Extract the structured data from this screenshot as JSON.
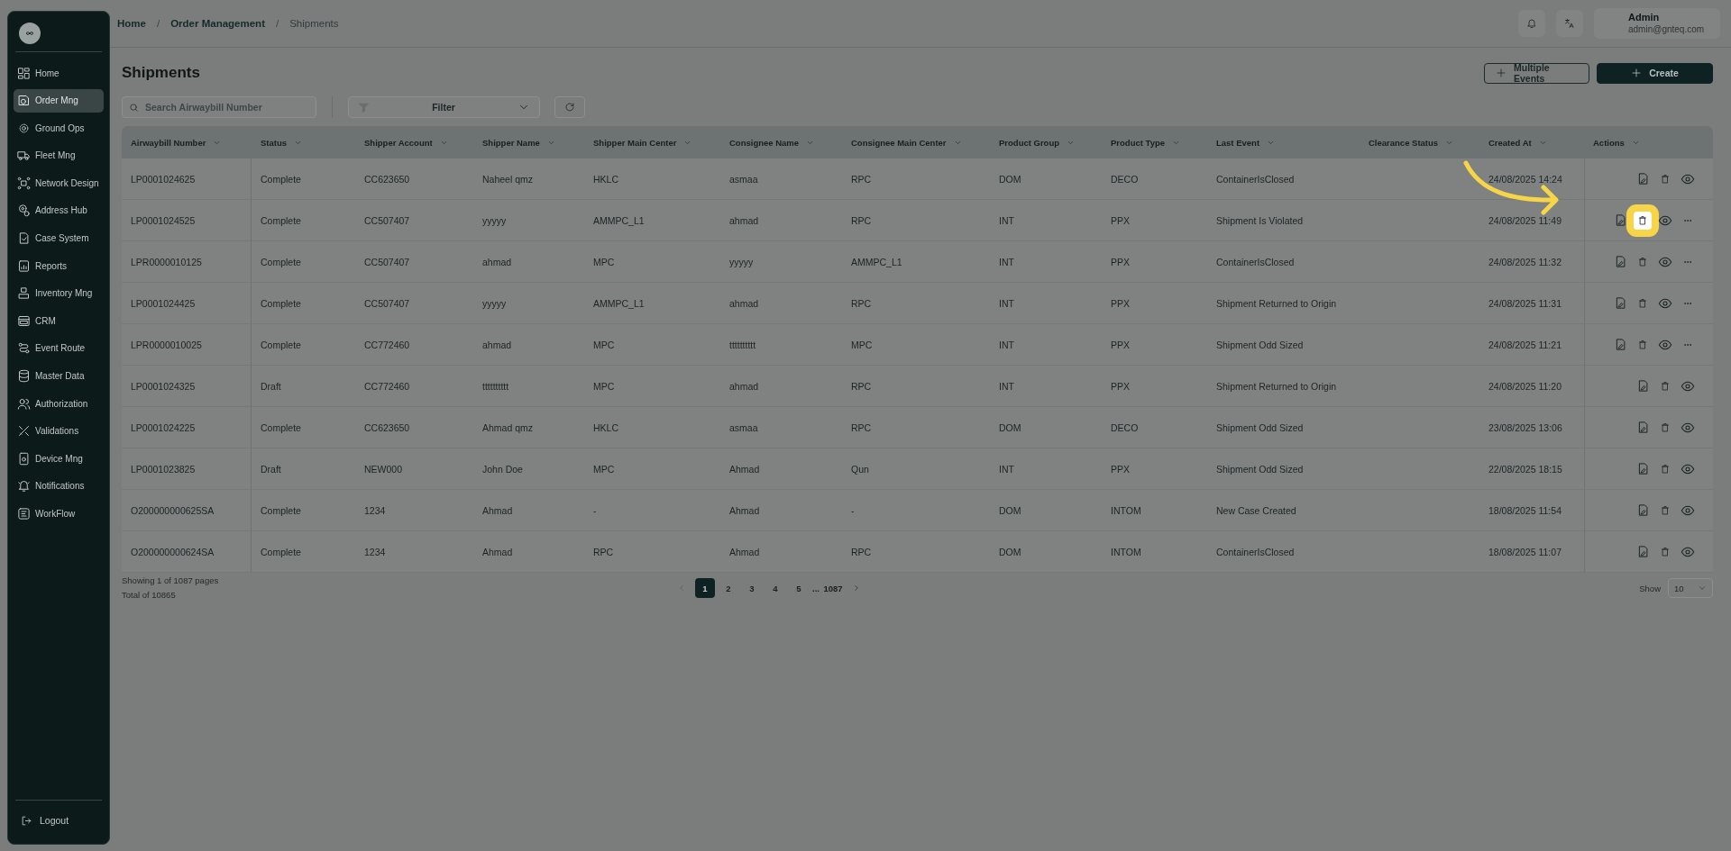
{
  "sidebar": {
    "items": [
      {
        "label": "Home",
        "selected": false
      },
      {
        "label": "Order Mng",
        "selected": true
      },
      {
        "label": "Ground Ops",
        "selected": false
      },
      {
        "label": "Fleet Mng",
        "selected": false
      },
      {
        "label": "Network Design",
        "selected": false
      },
      {
        "label": "Address Hub",
        "selected": false
      },
      {
        "label": "Case System",
        "selected": false
      },
      {
        "label": "Reports",
        "selected": false
      },
      {
        "label": "Inventory Mng",
        "selected": false
      },
      {
        "label": "CRM",
        "selected": false
      },
      {
        "label": "Event Route",
        "selected": false
      },
      {
        "label": "Master Data",
        "selected": false
      },
      {
        "label": "Authorization",
        "selected": false
      },
      {
        "label": "Validations",
        "selected": false
      },
      {
        "label": "Device Mng",
        "selected": false
      },
      {
        "label": "Notifications",
        "selected": false
      },
      {
        "label": "WorkFlow",
        "selected": false
      }
    ],
    "logout": "Logout"
  },
  "breadcrumb": [
    {
      "label": "Home",
      "current": false
    },
    {
      "label": "Order Management",
      "current": false
    },
    {
      "label": "Shipments",
      "current": true
    }
  ],
  "breadcrumb_separator": "/",
  "user": {
    "name": "Admin",
    "email": "admin@gnteq.com"
  },
  "page_title": "Shipments",
  "buttons": [
    {
      "label": "Multiple Events",
      "kind": "outline"
    },
    {
      "label": "Create",
      "kind": "primary"
    }
  ],
  "search": {
    "placeholder": "Search Airwaybill Number"
  },
  "filter": {
    "label": "Filter"
  },
  "table": {
    "columns": [
      "Airwaybill Number",
      "Status",
      "Shipper Account",
      "Shipper Name",
      "Shipper Main Center",
      "Consignee Name",
      "Consignee Main Center",
      "Product Group",
      "Product Type",
      "Last Event",
      "Clearance Status",
      "Created At",
      "Actions"
    ],
    "rows": [
      {
        "cells": [
          "LP0001024625",
          "Complete",
          "CC623650",
          "Naheel qmz",
          "HKLC",
          "asmaa",
          "RPC",
          "DOM",
          "DECO",
          "ContainerIsClosed",
          "",
          "24/08/2025 14:24"
        ],
        "more": false,
        "highlighted": false
      },
      {
        "cells": [
          "LP0001024525",
          "Complete",
          "CC507407",
          "yyyyy",
          "AMMPC_L1",
          "ahmad",
          "RPC",
          "INT",
          "PPX",
          "Shipment Is Violated",
          "",
          "24/08/2025 11:49"
        ],
        "more": true,
        "highlighted": true
      },
      {
        "cells": [
          "LPR0000010125",
          "Complete",
          "CC507407",
          "ahmad",
          "MPC",
          "yyyyy",
          "AMMPC_L1",
          "INT",
          "PPX",
          "ContainerIsClosed",
          "",
          "24/08/2025 11:32"
        ],
        "more": true,
        "highlighted": false
      },
      {
        "cells": [
          "LP0001024425",
          "Complete",
          "CC507407",
          "yyyyy",
          "AMMPC_L1",
          "ahmad",
          "RPC",
          "INT",
          "PPX",
          "Shipment Returned to Origin",
          "",
          "24/08/2025 11:31"
        ],
        "more": true,
        "highlighted": false
      },
      {
        "cells": [
          "LPR0000010025",
          "Complete",
          "CC772460",
          "ahmad",
          "MPC",
          "tttttttttt",
          "MPC",
          "INT",
          "PPX",
          "Shipment Odd Sized",
          "",
          "24/08/2025 11:21"
        ],
        "more": true,
        "highlighted": false
      },
      {
        "cells": [
          "LP0001024325",
          "Draft",
          "CC772460",
          "tttttttttt",
          "MPC",
          "ahmad",
          "RPC",
          "INT",
          "PPX",
          "Shipment Returned to Origin",
          "",
          "24/08/2025 11:20"
        ],
        "more": false,
        "highlighted": false
      },
      {
        "cells": [
          "LP0001024225",
          "Complete",
          "CC623650",
          "Ahmad qmz",
          "HKLC",
          "asmaa",
          "RPC",
          "DOM",
          "DECO",
          "Shipment Odd Sized",
          "",
          "23/08/2025 13:06"
        ],
        "more": false,
        "highlighted": false
      },
      {
        "cells": [
          "LP0001023825",
          "Draft",
          "NEW000",
          "John Doe",
          "MPC",
          "Ahmad",
          "Qun",
          "INT",
          "PPX",
          "Shipment Odd Sized",
          "",
          "22/08/2025 18:15"
        ],
        "more": false,
        "highlighted": false
      },
      {
        "cells": [
          "O200000000625SA",
          "Complete",
          "1234",
          "Ahmad",
          "-",
          "Ahmad",
          "-",
          "DOM",
          "INTOM",
          "New Case Created",
          "",
          "18/08/2025 11:54"
        ],
        "more": false,
        "highlighted": false
      },
      {
        "cells": [
          "O200000000624SA",
          "Complete",
          "1234",
          "Ahmad",
          "RPC",
          "Ahmad",
          "RPC",
          "DOM",
          "INTOM",
          "ContainerIsClosed",
          "",
          "18/08/2025 11:07"
        ],
        "more": false,
        "highlighted": false
      }
    ]
  },
  "footer": {
    "showing": "Showing 1 of 1087 pages",
    "total": "Total of 10865"
  },
  "pagination": [
    {
      "label": "1",
      "selected": true
    },
    {
      "label": "2",
      "selected": false
    },
    {
      "label": "3",
      "selected": false
    },
    {
      "label": "4",
      "selected": false
    },
    {
      "label": "5",
      "selected": false
    },
    {
      "label": "...",
      "kind": "gap",
      "selected": false
    },
    {
      "label": "1087",
      "selected": false
    }
  ],
  "page_size": {
    "label": "Show",
    "value": "10"
  },
  "callout_arrow": true
}
